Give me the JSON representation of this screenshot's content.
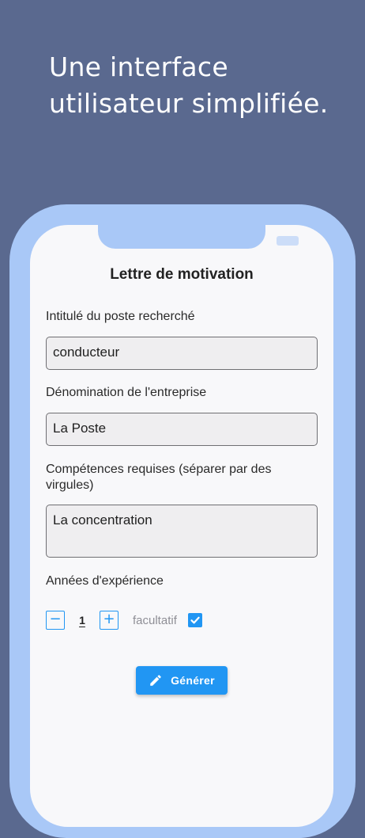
{
  "headline": {
    "line1": "Une interface",
    "line2": "utilisateur simplifiée."
  },
  "form": {
    "title": "Lettre de motivation",
    "job_title": {
      "label": "Intitulé du poste recherché",
      "value": "conducteur"
    },
    "company": {
      "label": "Dénomination de l'entreprise",
      "value": "La Poste"
    },
    "skills": {
      "label": "Compétences requises (séparer  par des virgules)",
      "value": "La concentration"
    },
    "experience": {
      "label": "Années d'expérience",
      "minus_symbol": "−",
      "plus_symbol": "+",
      "value": "1",
      "optional_label": "facultatif",
      "optional_checked": true
    },
    "generate_button": {
      "label": "Générer",
      "icon": "pencil-icon"
    }
  },
  "colors": {
    "background": "#5a698f",
    "phone_frame": "#a9c8f7",
    "screen": "#f8f8fa",
    "accent": "#2196f3"
  }
}
